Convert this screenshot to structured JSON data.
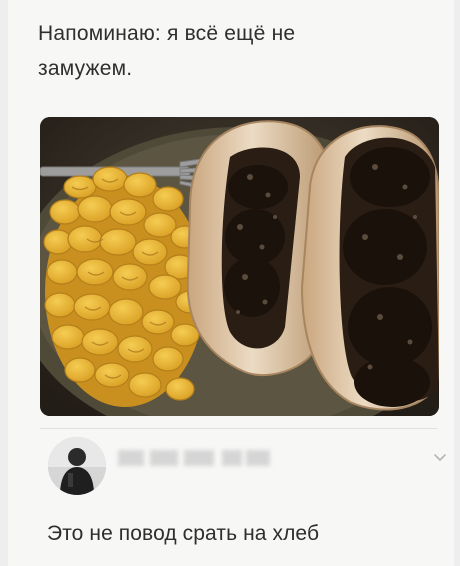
{
  "post": {
    "text": "Напоминаю: я всё ещё не замужем."
  },
  "reply": {
    "text": "Это не повод срать на хлеб"
  },
  "colors": {
    "background": "#eeeeee",
    "card": "#f7f7f6",
    "text": "#2f2f2f",
    "divider": "#e2e2e2"
  },
  "icons": {
    "expand": "chevron-down-icon"
  }
}
